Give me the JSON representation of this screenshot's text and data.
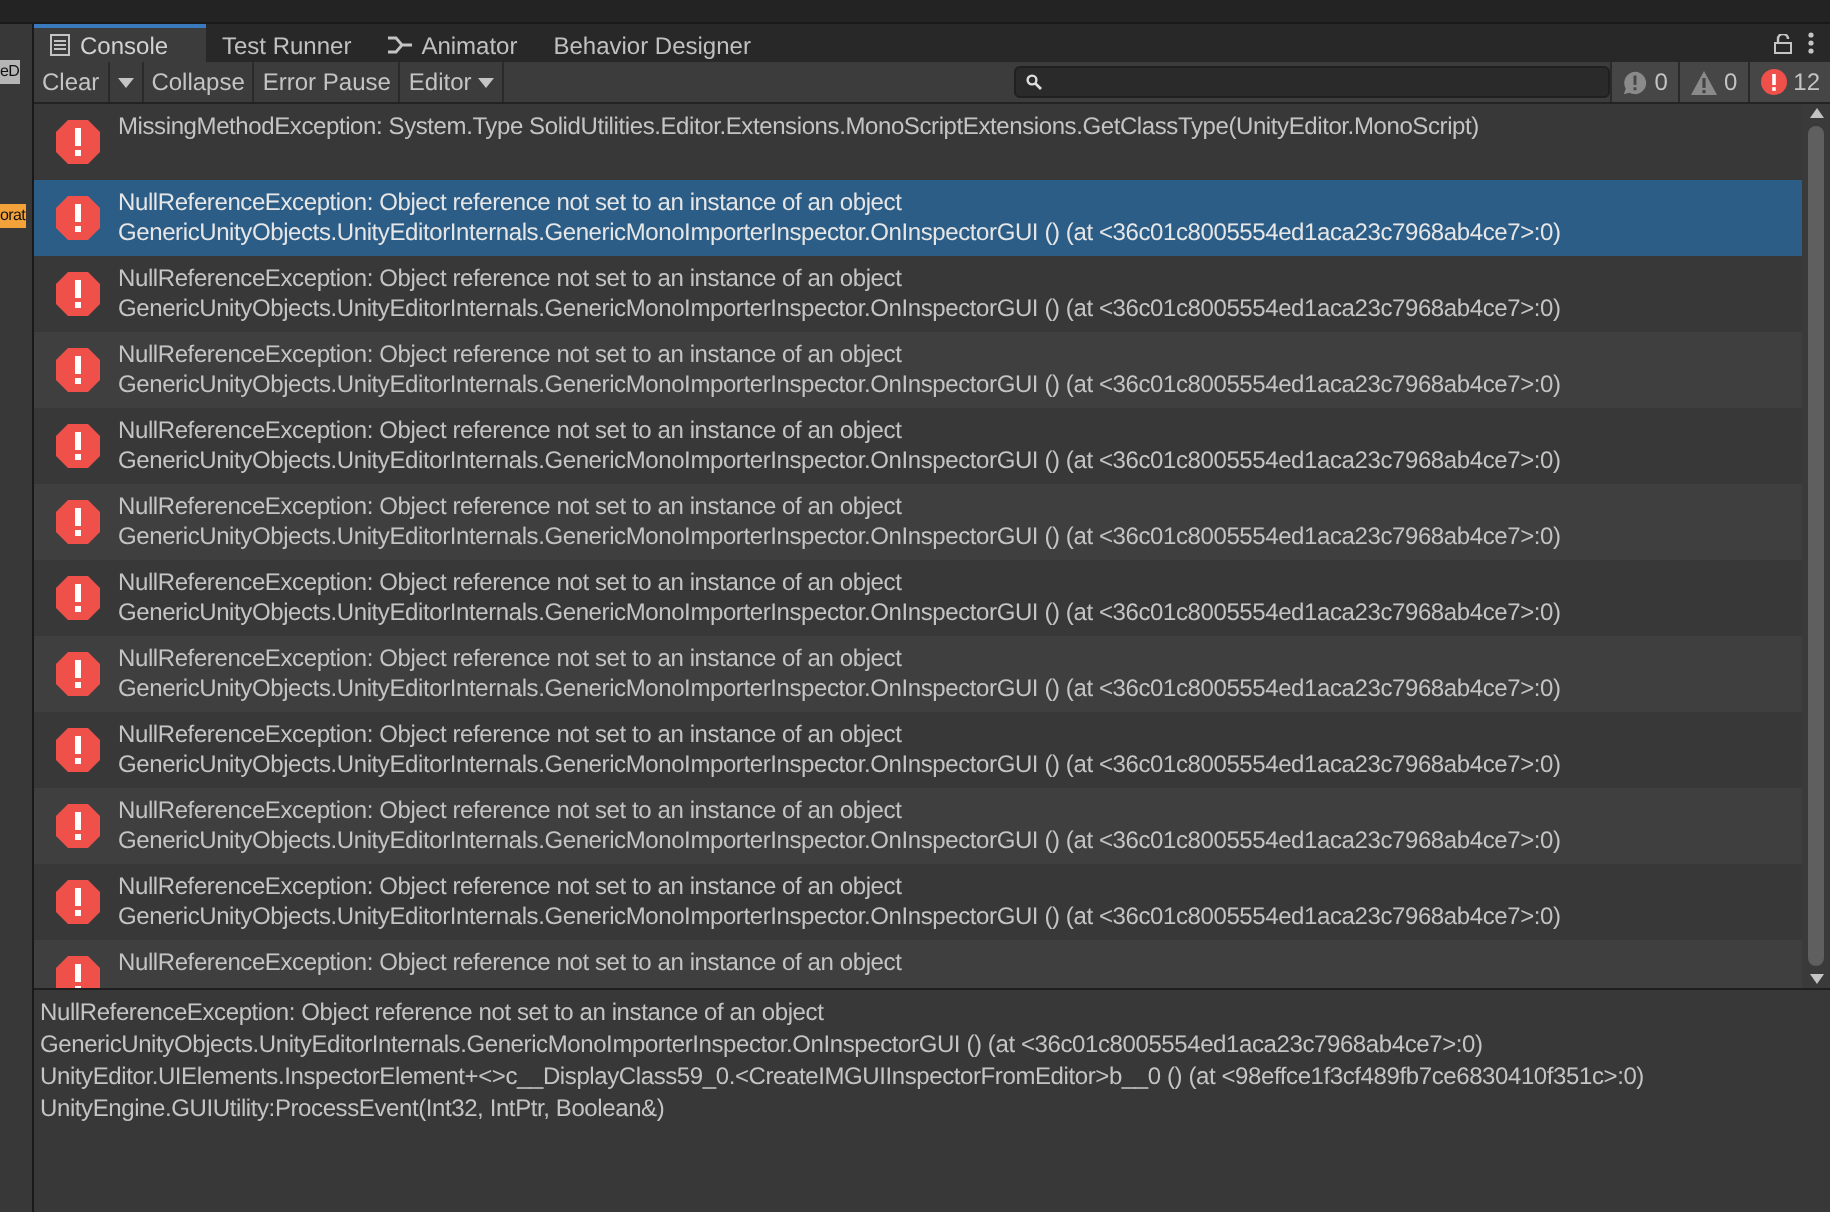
{
  "side_tags": [
    {
      "label": "eD",
      "kind": "grey"
    },
    {
      "label": "orat",
      "kind": "orange"
    }
  ],
  "tabs": [
    {
      "label": "Console",
      "kind": "log",
      "selected": true
    },
    {
      "label": "Test Runner",
      "kind": "plain",
      "selected": false
    },
    {
      "label": "Animator",
      "kind": "graph",
      "selected": false
    },
    {
      "label": "Behavior Designer",
      "kind": "plain",
      "selected": false
    }
  ],
  "toolbar": {
    "buttons": [
      {
        "label": "Clear",
        "kind": "plain"
      },
      {
        "kind": "dropdown"
      },
      {
        "label": "Collapse",
        "kind": "plain"
      },
      {
        "label": "Error Pause",
        "kind": "plain"
      },
      {
        "label": "Editor",
        "kind": "dropdown"
      }
    ],
    "counters": [
      {
        "kind": "info",
        "count": "0"
      },
      {
        "kind": "warning",
        "count": "0"
      },
      {
        "kind": "error",
        "count": "12"
      }
    ]
  },
  "entries": [
    {
      "selected": false,
      "lines": [
        "MissingMethodException: System.Type SolidUtilities.Editor.Extensions.MonoScriptExtensions.GetClassType(UnityEditor.MonoScript)"
      ]
    },
    {
      "selected": true,
      "lines": [
        "NullReferenceException: Object reference not set to an instance of an object",
        "GenericUnityObjects.UnityEditorInternals.GenericMonoImporterInspector.OnInspectorGUI () (at <36c01c8005554ed1aca23c7968ab4ce7>:0)"
      ]
    },
    {
      "selected": false,
      "lines": [
        "NullReferenceException: Object reference not set to an instance of an object",
        "GenericUnityObjects.UnityEditorInternals.GenericMonoImporterInspector.OnInspectorGUI () (at <36c01c8005554ed1aca23c7968ab4ce7>:0)"
      ]
    },
    {
      "selected": false,
      "lines": [
        "NullReferenceException: Object reference not set to an instance of an object",
        "GenericUnityObjects.UnityEditorInternals.GenericMonoImporterInspector.OnInspectorGUI () (at <36c01c8005554ed1aca23c7968ab4ce7>:0)"
      ]
    },
    {
      "selected": false,
      "lines": [
        "NullReferenceException: Object reference not set to an instance of an object",
        "GenericUnityObjects.UnityEditorInternals.GenericMonoImporterInspector.OnInspectorGUI () (at <36c01c8005554ed1aca23c7968ab4ce7>:0)"
      ]
    },
    {
      "selected": false,
      "lines": [
        "NullReferenceException: Object reference not set to an instance of an object",
        "GenericUnityObjects.UnityEditorInternals.GenericMonoImporterInspector.OnInspectorGUI () (at <36c01c8005554ed1aca23c7968ab4ce7>:0)"
      ]
    },
    {
      "selected": false,
      "lines": [
        "NullReferenceException: Object reference not set to an instance of an object",
        "GenericUnityObjects.UnityEditorInternals.GenericMonoImporterInspector.OnInspectorGUI () (at <36c01c8005554ed1aca23c7968ab4ce7>:0)"
      ]
    },
    {
      "selected": false,
      "lines": [
        "NullReferenceException: Object reference not set to an instance of an object",
        "GenericUnityObjects.UnityEditorInternals.GenericMonoImporterInspector.OnInspectorGUI () (at <36c01c8005554ed1aca23c7968ab4ce7>:0)"
      ]
    },
    {
      "selected": false,
      "lines": [
        "NullReferenceException: Object reference not set to an instance of an object",
        "GenericUnityObjects.UnityEditorInternals.GenericMonoImporterInspector.OnInspectorGUI () (at <36c01c8005554ed1aca23c7968ab4ce7>:0)"
      ]
    },
    {
      "selected": false,
      "lines": [
        "NullReferenceException: Object reference not set to an instance of an object",
        "GenericUnityObjects.UnityEditorInternals.GenericMonoImporterInspector.OnInspectorGUI () (at <36c01c8005554ed1aca23c7968ab4ce7>:0)"
      ]
    },
    {
      "selected": false,
      "lines": [
        "NullReferenceException: Object reference not set to an instance of an object",
        "GenericUnityObjects.UnityEditorInternals.GenericMonoImporterInspector.OnInspectorGUI () (at <36c01c8005554ed1aca23c7968ab4ce7>:0)"
      ]
    },
    {
      "selected": false,
      "lines": [
        "NullReferenceException: Object reference not set to an instance of an object"
      ]
    }
  ],
  "details": [
    "NullReferenceException: Object reference not set to an instance of an object",
    "GenericUnityObjects.UnityEditorInternals.GenericMonoImporterInspector.OnInspectorGUI () (at <36c01c8005554ed1aca23c7968ab4ce7>:0)",
    "UnityEditor.UIElements.InspectorElement+<>c__DisplayClass59_0.<CreateIMGUIInspectorFromEditor>b__0 () (at <98effce1f3cf489fb7ce6830410f351c>:0)",
    "UnityEngine.GUIUtility:ProcessEvent(Int32, IntPtr, Boolean&)"
  ]
}
